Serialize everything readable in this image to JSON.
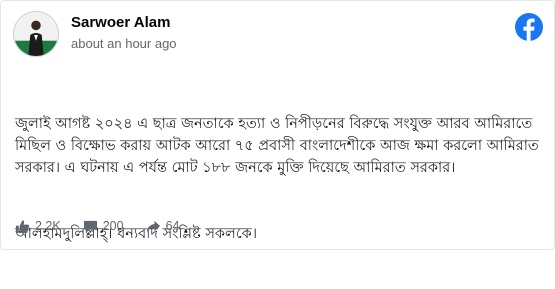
{
  "post": {
    "author": "Sarwoer Alam",
    "timestamp": "about an hour ago",
    "paragraphs": [
      "জুলাই আগষ্ট ২০২৪ এ ছাত্র জনতাকে হত্যা ও নিপীড়নের বিরুদ্ধে সংযুক্ত আরব আমিরাতে মিছিল ও বিক্ষোভ করায় আটক আরো ৭৫ প্রবাসী বাংলাদেশীকে আজ ক্ষমা করলো আমিরাত সরকার। এ ঘটনায় এ পর্যন্ত মোট ১৮৮ জনকে মুক্তি দিয়েছে আমিরাত সরকার।",
      "আলহামদুলিল্লাহ্। ধন্যবাদ সংশ্লিষ্ট সকলকে।"
    ]
  },
  "stats": {
    "likes": "2.2K",
    "comments": "200",
    "shares": "64"
  },
  "icons": {
    "brand": "facebook-logo-icon",
    "like": "thumbs-up-icon",
    "comment": "comment-bubble-icon",
    "share": "share-arrow-icon"
  },
  "colors": {
    "brand_blue": "#1877f2",
    "muted_text": "#65676b",
    "stat_icon": "#606770"
  }
}
